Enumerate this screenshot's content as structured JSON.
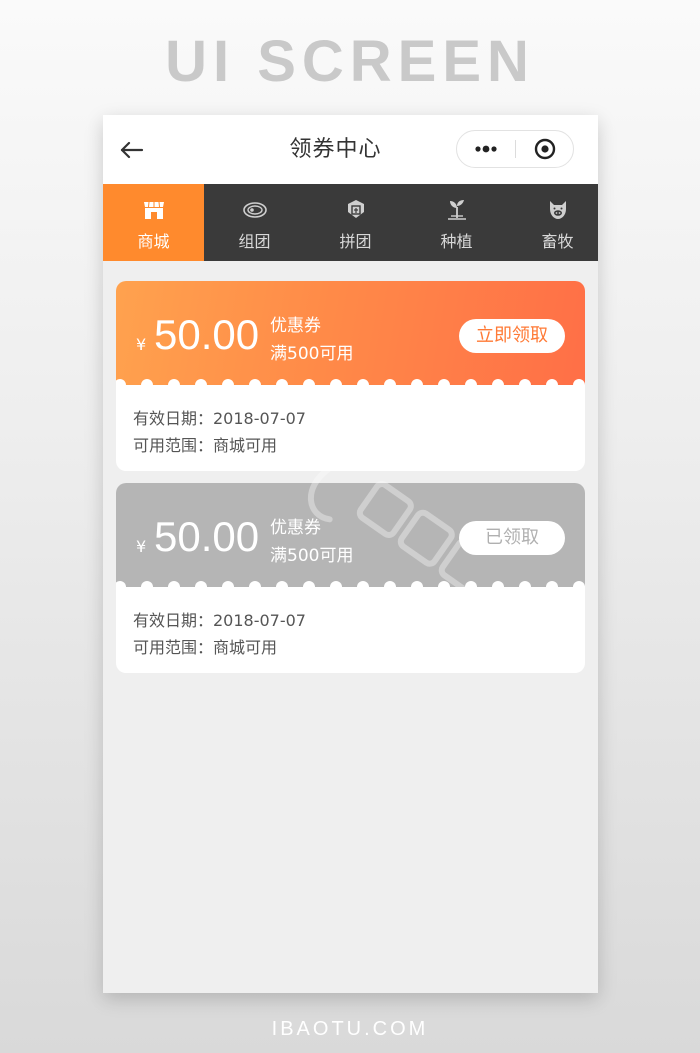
{
  "banner": {
    "title": "UI SCREEN"
  },
  "footer": {
    "site": "IBAOTU.COM"
  },
  "navbar": {
    "title": "领券中心",
    "back_icon": "back-arrow-icon",
    "more_icon": "more-dots-icon",
    "target_icon": "target-icon"
  },
  "tabs": [
    {
      "label": "商城",
      "icon": "shop-icon",
      "active": true
    },
    {
      "label": "组团",
      "icon": "meat-icon",
      "active": false
    },
    {
      "label": "拼团",
      "icon": "group-badge-icon",
      "active": false
    },
    {
      "label": "种植",
      "icon": "sprout-icon",
      "active": false
    },
    {
      "label": "畜牧",
      "icon": "pig-icon",
      "active": false
    }
  ],
  "coupons": [
    {
      "currency": "¥",
      "amount": "50.00",
      "type": "优惠券",
      "condition": "满500可用",
      "action": "立即领取",
      "validity": "有效日期：2018-07-07",
      "scope": "可用范围：商城可用",
      "status": "available"
    },
    {
      "currency": "¥",
      "amount": "50.00",
      "type": "优惠券",
      "condition": "满500可用",
      "action": "已领取",
      "validity": "有效日期：2018-07-07",
      "scope": "可用范围：商城可用",
      "status": "claimed"
    }
  ],
  "colors": {
    "accent": "#ff8a2d",
    "tab_bar": "#3a3a3a",
    "coupon_grey": "#b5b5b5"
  }
}
